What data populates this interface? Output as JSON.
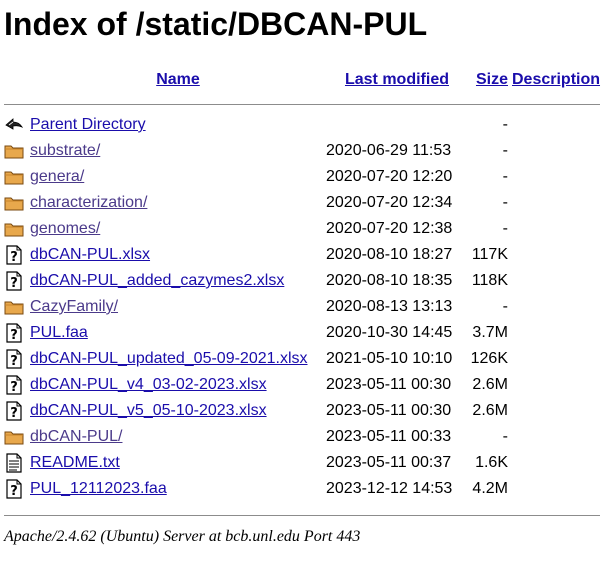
{
  "page": {
    "title": "Index of /static/DBCAN-PUL",
    "footer": "Apache/2.4.62 (Ubuntu) Server at bcb.unl.edu Port 443"
  },
  "columns": {
    "name": "Name",
    "last_modified": "Last modified",
    "size": "Size",
    "description": "Description"
  },
  "rows": [
    {
      "icon": "back-icon",
      "name": "Parent Directory",
      "date": "",
      "size": "-",
      "visited": false
    },
    {
      "icon": "folder-icon",
      "name": "substrate/",
      "date": "2020-06-29 11:53",
      "size": "-",
      "visited": true
    },
    {
      "icon": "folder-icon",
      "name": "genera/",
      "date": "2020-07-20 12:20",
      "size": "-",
      "visited": true
    },
    {
      "icon": "folder-icon",
      "name": "characterization/",
      "date": "2020-07-20 12:34",
      "size": "-",
      "visited": true
    },
    {
      "icon": "folder-icon",
      "name": "genomes/",
      "date": "2020-07-20 12:38",
      "size": "-",
      "visited": true
    },
    {
      "icon": "unknown-file-icon",
      "name": "dbCAN-PUL.xlsx",
      "date": "2020-08-10 18:27",
      "size": "117K",
      "visited": false
    },
    {
      "icon": "unknown-file-icon",
      "name": "dbCAN-PUL_added_cazymes2.xlsx",
      "date": "2020-08-10 18:35",
      "size": "118K",
      "visited": false
    },
    {
      "icon": "folder-icon",
      "name": "CazyFamily/",
      "date": "2020-08-13 13:13",
      "size": "-",
      "visited": true
    },
    {
      "icon": "unknown-file-icon",
      "name": "PUL.faa",
      "date": "2020-10-30 14:45",
      "size": "3.7M",
      "visited": false
    },
    {
      "icon": "unknown-file-icon",
      "name": "dbCAN-PUL_updated_05-09-2021.xlsx",
      "date": "2021-05-10 10:10",
      "size": "126K",
      "visited": false
    },
    {
      "icon": "unknown-file-icon",
      "name": "dbCAN-PUL_v4_03-02-2023.xlsx",
      "date": "2023-05-11 00:30",
      "size": "2.6M",
      "visited": false
    },
    {
      "icon": "unknown-file-icon",
      "name": "dbCAN-PUL_v5_05-10-2023.xlsx",
      "date": "2023-05-11 00:30",
      "size": "2.6M",
      "visited": false
    },
    {
      "icon": "folder-icon",
      "name": "dbCAN-PUL/",
      "date": "2023-05-11 00:33",
      "size": "-",
      "visited": true
    },
    {
      "icon": "text-file-icon",
      "name": "README.txt",
      "date": "2023-05-11 00:37",
      "size": "1.6K",
      "visited": false
    },
    {
      "icon": "unknown-file-icon",
      "name": "PUL_12112023.faa",
      "date": "2023-12-12 14:53",
      "size": "4.2M",
      "visited": false
    }
  ]
}
